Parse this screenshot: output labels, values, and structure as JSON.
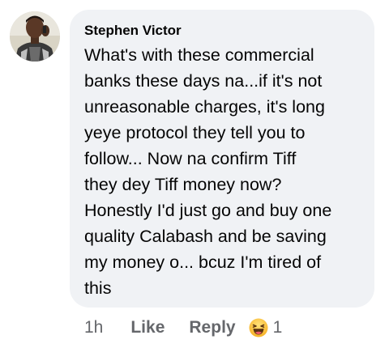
{
  "comment": {
    "author": "Stephen Victor",
    "lines": [
      "What's with these commercial",
      "banks these days na...if it's not",
      "unreasonable charges, it's long",
      "yeye protocol they tell you to",
      "follow... Now na confirm Tiff",
      "they dey Tiff money now?",
      "Honestly I'd just go and buy one",
      "quality Calabash and be saving",
      "my money o... bcuz I'm tired of",
      "this"
    ]
  },
  "actions": {
    "time": "1h",
    "like_label": "Like",
    "reply_label": "Reply",
    "reaction_icon": "laughing-emoji-icon",
    "reaction_count": "1"
  },
  "colors": {
    "bubble": "#f0f2f5",
    "text": "#050505",
    "secondary": "#65676b"
  }
}
